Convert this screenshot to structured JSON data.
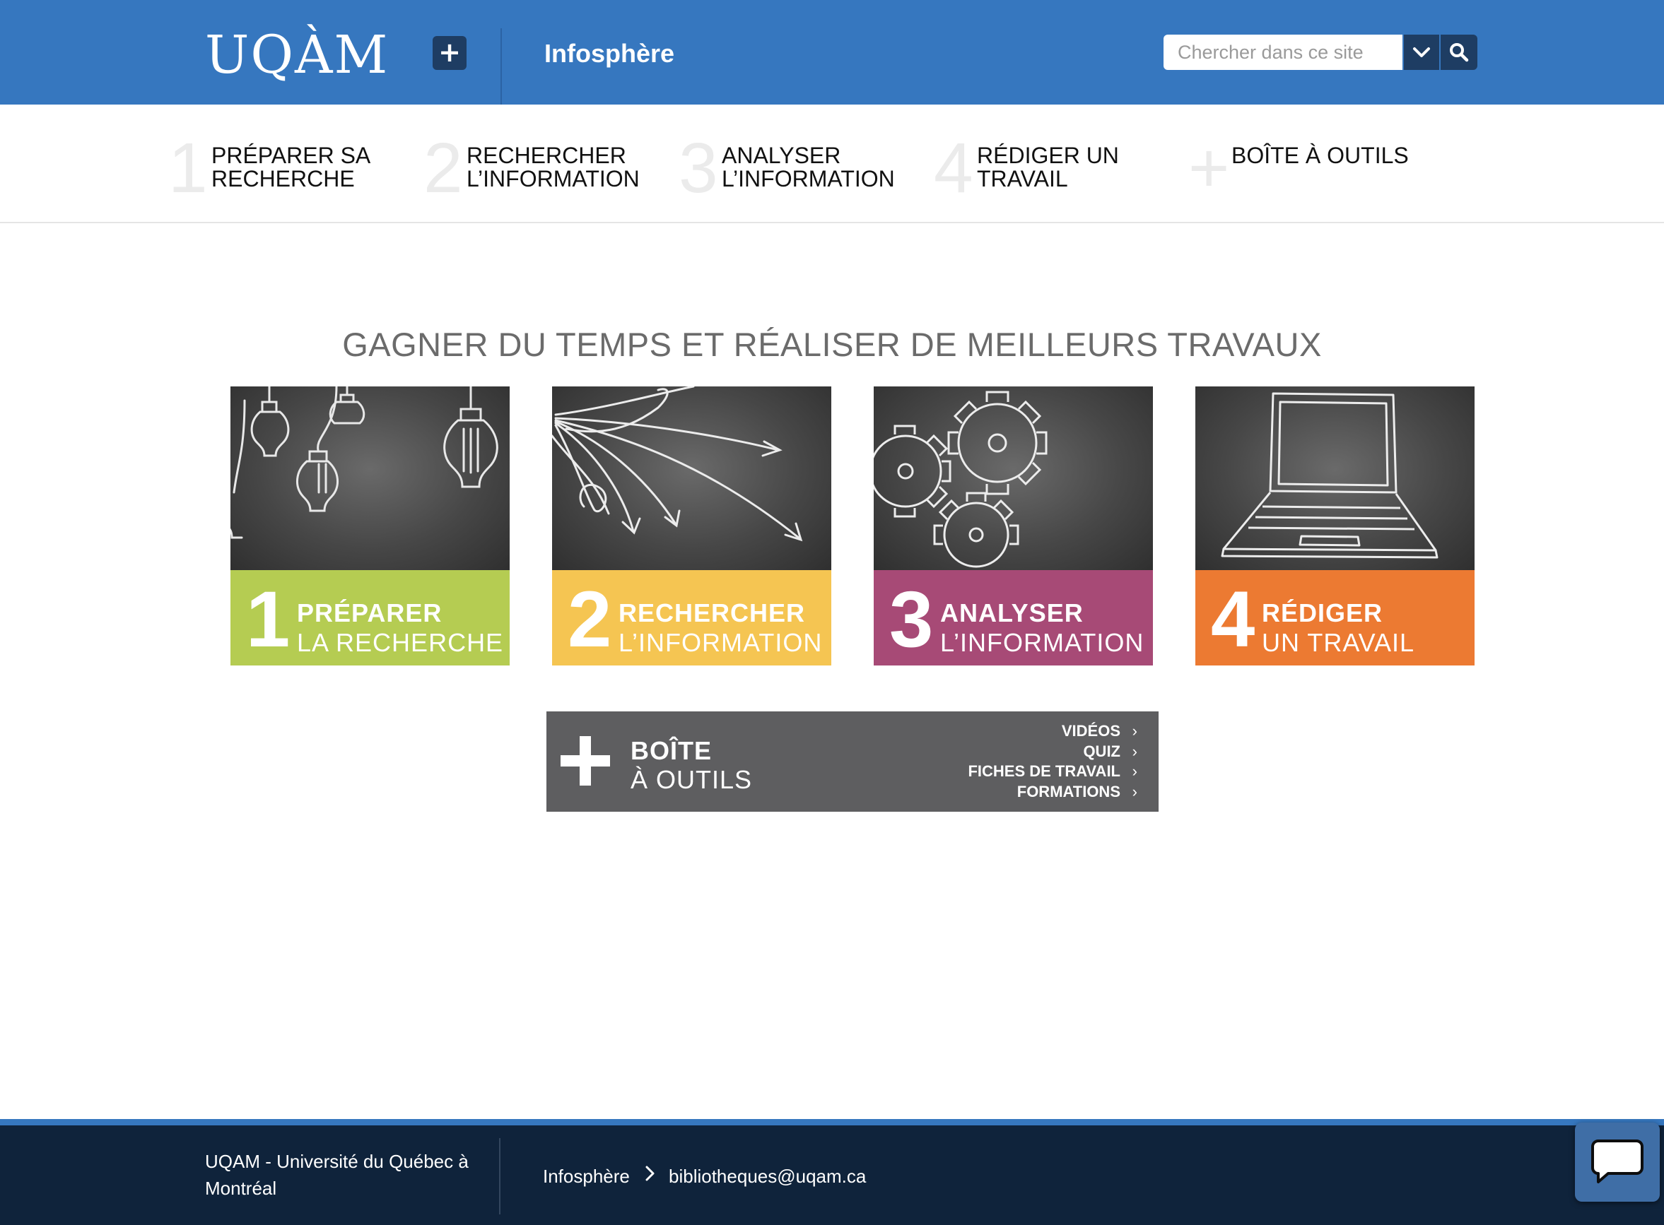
{
  "header": {
    "logo": "UQÀM",
    "plus_label": "+",
    "site_title": "Infosphère",
    "search": {
      "placeholder": "Chercher dans ce site"
    }
  },
  "steps": [
    {
      "num": "1",
      "label": "Préparer sa recherche"
    },
    {
      "num": "2",
      "label": "Rechercher l’information"
    },
    {
      "num": "3",
      "label": "Analyser l’information"
    },
    {
      "num": "4",
      "label": "Rédiger un travail"
    },
    {
      "num": "+",
      "label": "Boîte à outils"
    }
  ],
  "main": {
    "headline": "GAGNER DU TEMPS ET RÉALISER DE MEILLEURS TRAVAUX",
    "cards": [
      {
        "num": "1",
        "title": "PRÉPARER",
        "subtitle": "LA RECHERCHE",
        "color": "#b5cc52",
        "icon": "light-bulbs-illustration"
      },
      {
        "num": "2",
        "title": "RECHERCHER",
        "subtitle": "L’INFORMATION",
        "color": "#f5c552",
        "icon": "arrows-illustration"
      },
      {
        "num": "3",
        "title": "ANALYSER",
        "subtitle": "L’INFORMATION",
        "color": "#a74a76",
        "icon": "gears-illustration"
      },
      {
        "num": "4",
        "title": "RÉDIGER",
        "subtitle": "UN TRAVAIL",
        "color": "#ec7a32",
        "icon": "laptop-illustration"
      }
    ],
    "toolbox": {
      "title": "BOÎTE",
      "subtitle": "À OUTILS",
      "links": [
        "VIDÉOS",
        "QUIZ",
        "FICHES DE TRAVAIL",
        "FORMATIONS"
      ],
      "color": "#5e5e60"
    }
  },
  "footer": {
    "institution": "UQAM - Université du Québec à Montréal",
    "breadcrumb": "Infosphère",
    "email": "bibliotheques@uqam.ca"
  },
  "colors": {
    "brand": "#3677bf",
    "dark": "#1e3d63",
    "footer": "#0f233b"
  }
}
